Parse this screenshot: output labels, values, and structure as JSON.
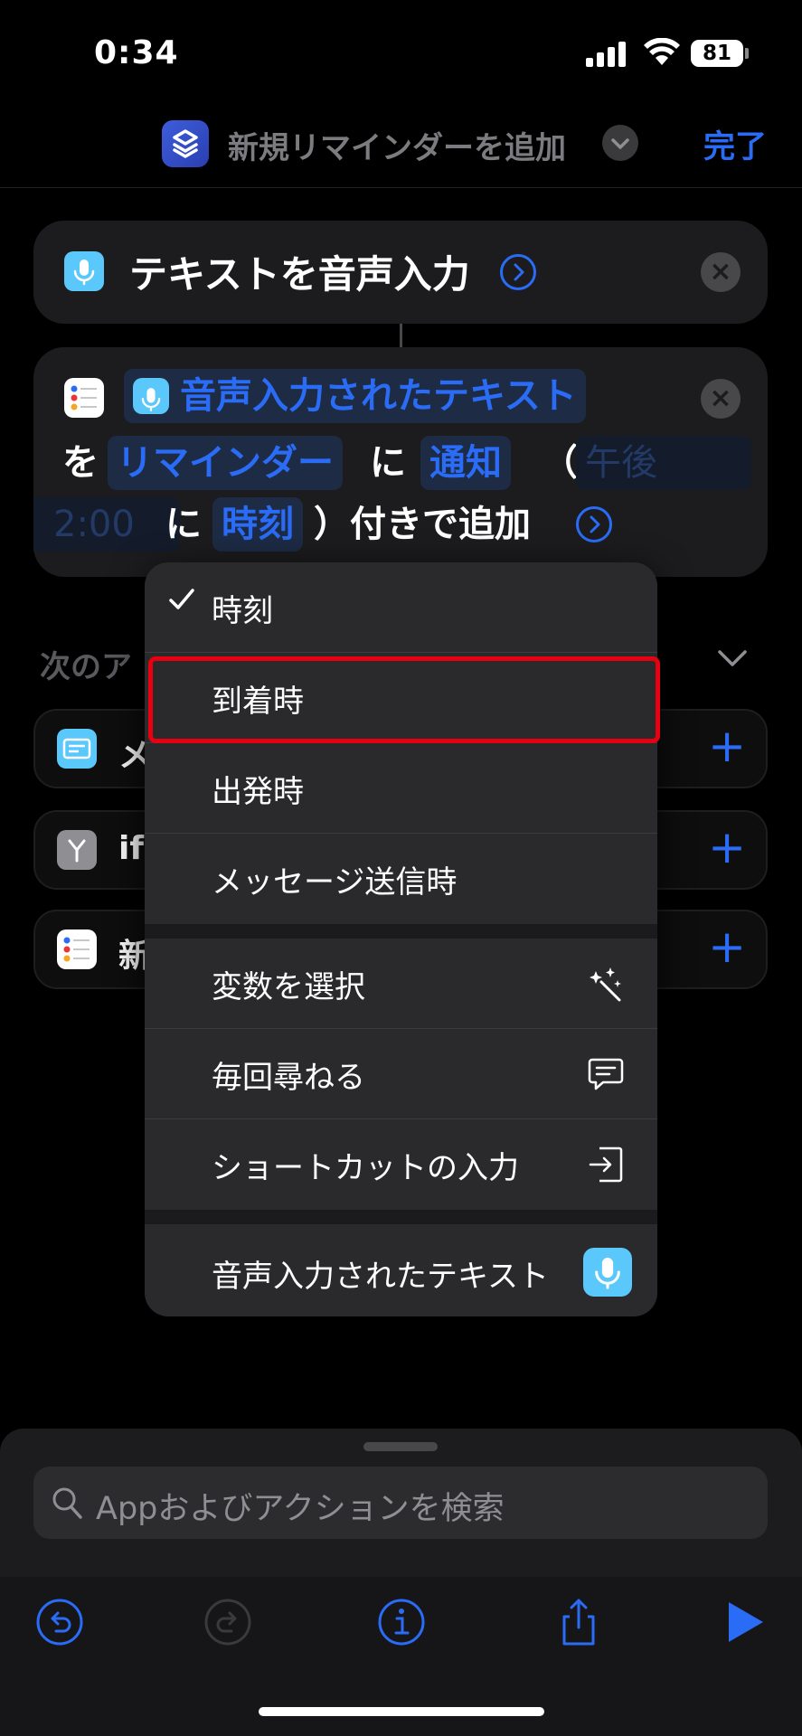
{
  "status_bar": {
    "time": "0:34",
    "battery": "81"
  },
  "nav": {
    "title": "新規リマインダーを追加",
    "done_label": "完了"
  },
  "action1": {
    "title": "テキストを音声入力"
  },
  "action2": {
    "token_dictated": "音声入力されたテキスト",
    "word_wo": "を",
    "token_reminders": "リマインダー",
    "word_ni1": "に",
    "token_notify": "通知",
    "paren_open": "（",
    "token_time_a": "午後",
    "token_time_b": "2:00",
    "word_ni2": "に",
    "token_time_kind": "時刻",
    "paren_close_text": "）付きで追加"
  },
  "suggestions": {
    "section_label": "次のア",
    "items": [
      {
        "label": "メ"
      },
      {
        "label": "if"
      },
      {
        "label": "新"
      }
    ]
  },
  "menu": {
    "items": [
      {
        "label": "時刻",
        "checked": true
      },
      {
        "label": "到着時"
      },
      {
        "label": "出発時"
      },
      {
        "label": "メッセージ送信時"
      }
    ],
    "extra": [
      {
        "label": "変数を選択",
        "icon": "magic-wand-icon"
      },
      {
        "label": "毎回尋ねる",
        "icon": "speech-bubble-icon"
      },
      {
        "label": "ショートカットの入力",
        "icon": "input-arrow-icon"
      }
    ],
    "variable": {
      "label": "音声入力されたテキスト",
      "icon": "microphone-icon"
    }
  },
  "search": {
    "placeholder": "Appおよびアクションを検索"
  },
  "colors": {
    "accent": "#2a6cf6",
    "highlight": "#e60012",
    "mic": "#5ac8fa"
  }
}
